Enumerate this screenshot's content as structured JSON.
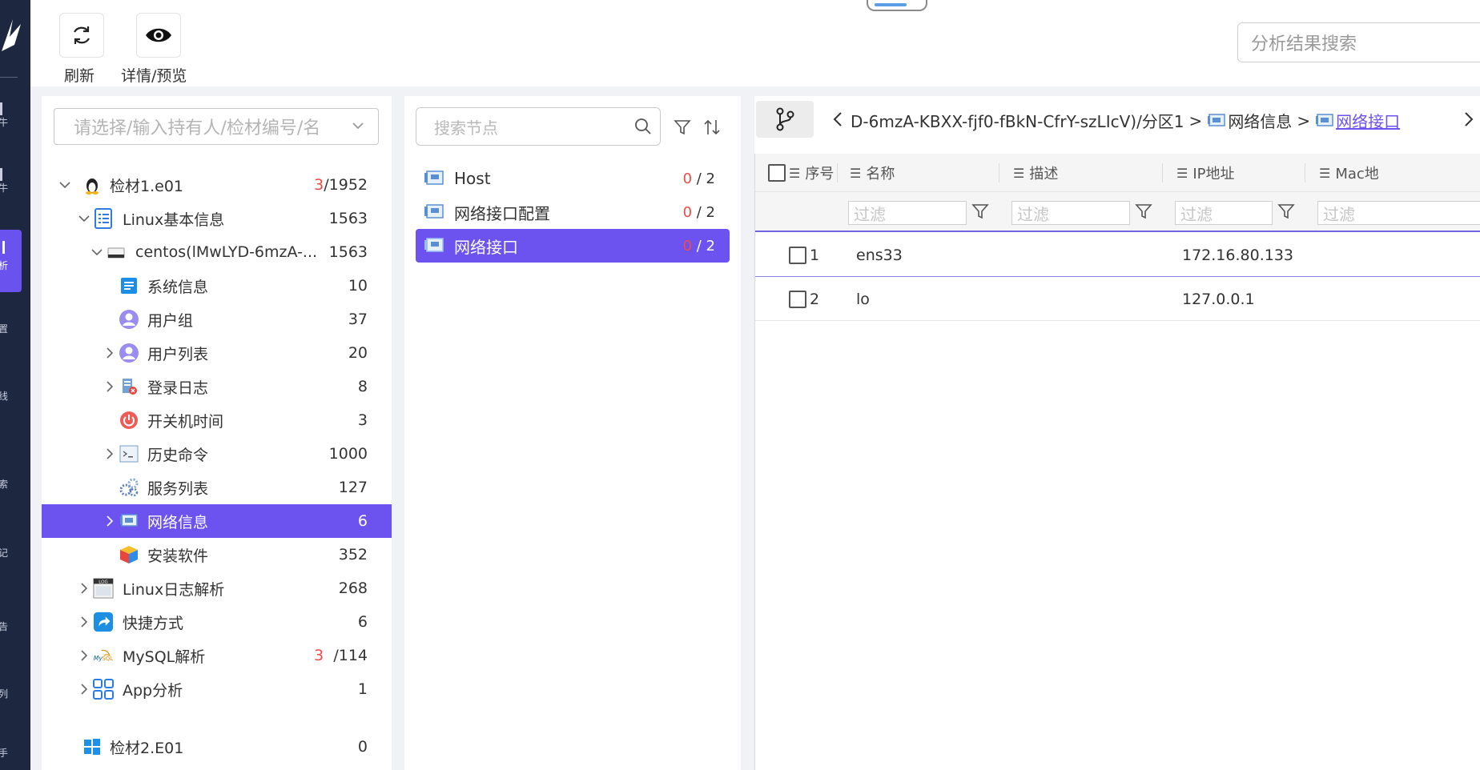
{
  "toolbar": {
    "refresh_label": "刷新",
    "detail_label": "详情/预览",
    "search_placeholder": "分析结果搜索"
  },
  "left_rail": {
    "glyphs": [
      "牛",
      "牛",
      "析",
      "置",
      "线",
      "索",
      "记",
      "告",
      "列",
      "手"
    ]
  },
  "tree": {
    "owner_placeholder": "请选择/输入持有人/检材编号/名",
    "items": [
      {
        "label": "检材1.e01",
        "count_red": "3",
        "count": "/1952",
        "icon": "linux-penguin-icon"
      },
      {
        "label": "Linux基本信息",
        "count": "1563",
        "icon": "list-doc-icon"
      },
      {
        "label": "centos(lMwLYD-6mzA-...",
        "count": "1563",
        "icon": "disk-icon"
      },
      {
        "label": "系统信息",
        "count": "10",
        "icon": "system-info-icon"
      },
      {
        "label": "用户组",
        "count": "37",
        "icon": "user-group-icon"
      },
      {
        "label": "用户列表",
        "count": "20",
        "icon": "user-list-icon"
      },
      {
        "label": "登录日志",
        "count": "8",
        "icon": "login-log-icon"
      },
      {
        "label": "开关机时间",
        "count": "3",
        "icon": "power-icon"
      },
      {
        "label": "历史命令",
        "count": "1000",
        "icon": "terminal-icon"
      },
      {
        "label": "服务列表",
        "count": "127",
        "icon": "service-gear-icon"
      },
      {
        "label": "网络信息",
        "count": "6",
        "icon": "network-card-icon"
      },
      {
        "label": "安装软件",
        "count": "352",
        "icon": "package-cube-icon"
      },
      {
        "label": "Linux日志解析",
        "count": "268",
        "icon": "log-icon"
      },
      {
        "label": "快捷方式",
        "count": "6",
        "icon": "shortcut-icon"
      },
      {
        "label": "MySQL解析",
        "count_red": "3",
        "count": "/114",
        "icon": "mysql-icon"
      },
      {
        "label": "App分析",
        "count": "1",
        "icon": "app-grid-icon"
      },
      {
        "label": "检材2.E01",
        "count": "0",
        "icon": "windows-icon"
      }
    ]
  },
  "nodes": {
    "search_placeholder": "搜索节点",
    "items": [
      {
        "label": "Host",
        "red": "0",
        "total": " / 2"
      },
      {
        "label": "网络接口配置",
        "red": "0",
        "total": " / 2"
      },
      {
        "label": "网络接口",
        "red": "0",
        "total": " / 2"
      }
    ]
  },
  "breadcrumb": {
    "path": "D-6mzA-KBXX-fjf0-fBkN-CfrY-szLIcV)/分区1",
    "level1": "网络信息",
    "level2": "网络接口"
  },
  "table": {
    "columns": [
      "序号",
      "名称",
      "描述",
      "IP地址",
      "Mac地"
    ],
    "filter_placeholder": "过滤",
    "rows": [
      {
        "index": "1",
        "name": "ens33",
        "desc": "",
        "ip": "172.16.80.133"
      },
      {
        "index": "2",
        "name": "lo",
        "desc": "",
        "ip": "127.0.0.1"
      }
    ]
  },
  "colors": {
    "accent": "#6c52ef",
    "sidebar": "#1e2740",
    "alert_red": "#f04a4a"
  }
}
